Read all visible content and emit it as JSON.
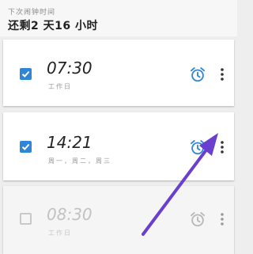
{
  "header": {
    "next_alarm_label": "下次闹钟时间",
    "remaining_text": "还剩2 天16 小时"
  },
  "alarms": [
    {
      "time": "07:30",
      "days": "工作日",
      "enabled": true
    },
    {
      "time": "14:21",
      "days": "周一，周二，周三",
      "enabled": true
    },
    {
      "time": "08:30",
      "days": "工作日",
      "enabled": false
    }
  ],
  "colors": {
    "accent": "#2f86d6",
    "arrow": "#6a3fd0",
    "background": "#eeeeee",
    "card": "#ffffff"
  },
  "icons": {
    "alarm": "alarm-clock-icon",
    "more": "more-vertical-icon",
    "check": "check-icon"
  }
}
